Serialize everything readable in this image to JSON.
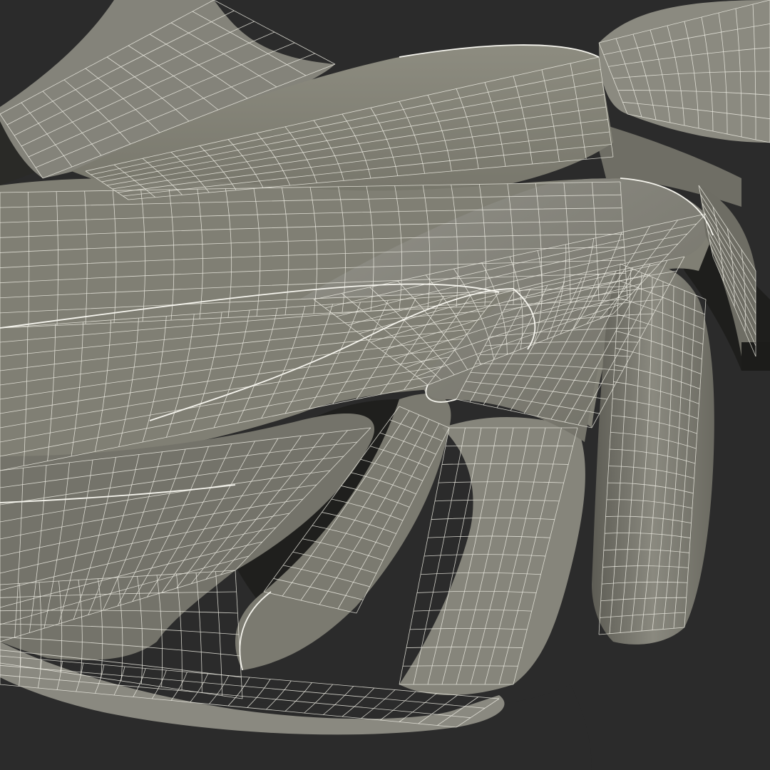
{
  "colors": {
    "background": "#2b2b2b",
    "surface_light": "#8e8d81",
    "surface_mid": "#7a796e",
    "surface_dark": "#55544c",
    "shadow": "#1f1f1d",
    "wire": "#ecebe2"
  }
}
